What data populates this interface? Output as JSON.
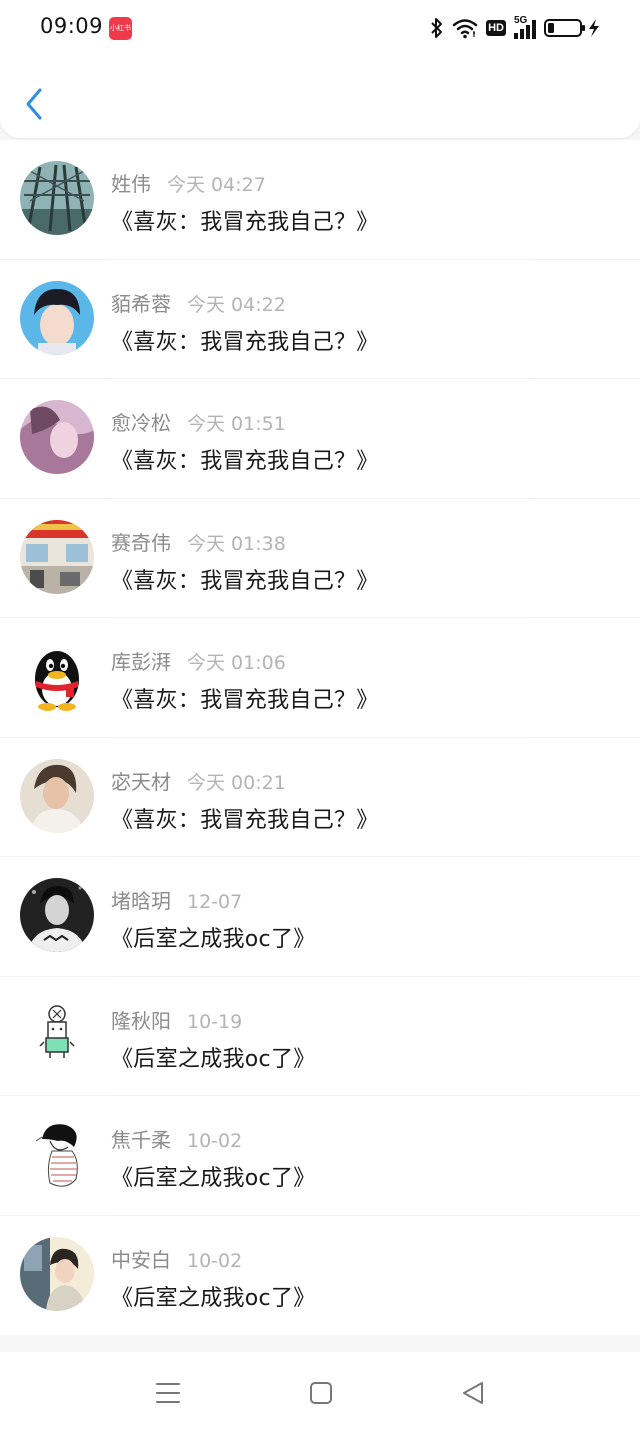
{
  "status_bar": {
    "time": "09:09",
    "app_badge": "小红书",
    "icons": [
      "bluetooth-icon",
      "wifi-icon",
      "hd-icon",
      "5g-signal-icon",
      "battery-charging-icon"
    ],
    "hd_label": "HD",
    "network_label": "5G"
  },
  "header": {
    "back_icon": "chevron-left-icon"
  },
  "messages": [
    {
      "name": "姓伟",
      "time": "今天 04:27",
      "text": "《喜灰：我冒充我自己？》"
    },
    {
      "name": "貊希蓉",
      "time": "今天 04:22",
      "text": "《喜灰：我冒充我自己？》"
    },
    {
      "name": "愈冷松",
      "time": "今天 01:51",
      "text": "《喜灰：我冒充我自己？》"
    },
    {
      "name": "赛奇伟",
      "time": "今天 01:38",
      "text": "《喜灰：我冒充我自己？》"
    },
    {
      "name": "库彭湃",
      "time": "今天 01:06",
      "text": "《喜灰：我冒充我自己？》"
    },
    {
      "name": "宓天材",
      "time": "今天 00:21",
      "text": "《喜灰：我冒充我自己？》"
    },
    {
      "name": "堵晗玥",
      "time": "12-07",
      "text": "《后室之成我oc了》"
    },
    {
      "name": "隆秋阳",
      "time": "10-19",
      "text": "《后室之成我oc了》"
    },
    {
      "name": "焦千柔",
      "time": "10-02",
      "text": "《后室之成我oc了》"
    },
    {
      "name": "中安白",
      "time": "10-02",
      "text": "《后室之成我oc了》"
    }
  ],
  "nav_bar": {
    "icons": [
      "menu-icon",
      "home-square-icon",
      "back-triangle-icon"
    ]
  },
  "colors": {
    "accent": "#2d8ee0",
    "name_gray": "#8c8c8c",
    "time_gray": "#b4b4b4",
    "message_text": "#1a1a1a",
    "badge_red": "#ee3a4b"
  }
}
